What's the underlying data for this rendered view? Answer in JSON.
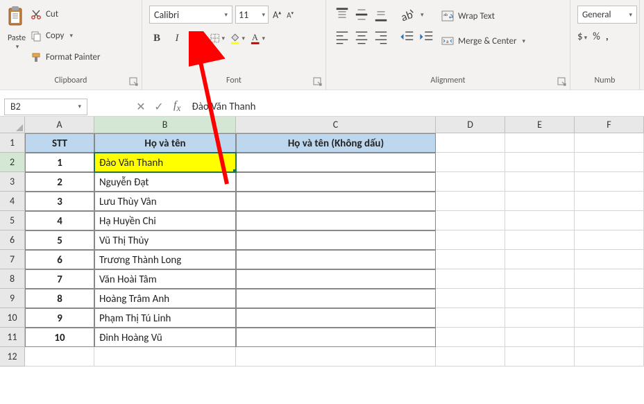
{
  "ribbon": {
    "clipboard": {
      "paste": "Paste",
      "cut": "Cut",
      "copy": "Copy",
      "format_painter": "Format Painter",
      "label": "Clipboard"
    },
    "font": {
      "name": "Calibri",
      "size": "11",
      "label": "Font"
    },
    "alignment": {
      "wrap": "Wrap Text",
      "merge": "Merge & Center",
      "label": "Alignment"
    },
    "number": {
      "format": "General",
      "label": "Numb"
    }
  },
  "namebox": "B2",
  "formula": "Đào Văn Thanh",
  "columns": [
    "A",
    "B",
    "C",
    "D",
    "E",
    "F"
  ],
  "headers": {
    "stt": "STT",
    "name": "Họ và tên",
    "noaccent": "Họ và tên (Không dấu)"
  },
  "rows": [
    {
      "n": "1",
      "stt": "1",
      "name": "Đào Văn Thanh",
      "na": ""
    },
    {
      "n": "2",
      "stt": "2",
      "name": "Nguyễn Đạt",
      "na": ""
    },
    {
      "n": "3",
      "stt": "3",
      "name": "Lưu Thùy Vân",
      "na": ""
    },
    {
      "n": "4",
      "stt": "4",
      "name": "Hạ Huyền Chi",
      "na": ""
    },
    {
      "n": "5",
      "stt": "5",
      "name": "Vũ Thị Thủy",
      "na": ""
    },
    {
      "n": "6",
      "stt": "6",
      "name": "Trương Thành Long",
      "na": ""
    },
    {
      "n": "7",
      "stt": "7",
      "name": "Văn Hoài Tâm",
      "na": ""
    },
    {
      "n": "8",
      "stt": "8",
      "name": "Hoàng Trâm Anh",
      "na": ""
    },
    {
      "n": "9",
      "stt": "9",
      "name": "Phạm Thị Tú Linh",
      "na": ""
    },
    {
      "n": "10",
      "stt": "10",
      "name": "Đinh Hoàng Vũ",
      "na": ""
    }
  ],
  "row_labels": [
    "1",
    "2",
    "3",
    "4",
    "5",
    "6",
    "7",
    "8",
    "9",
    "10",
    "11",
    "12"
  ]
}
